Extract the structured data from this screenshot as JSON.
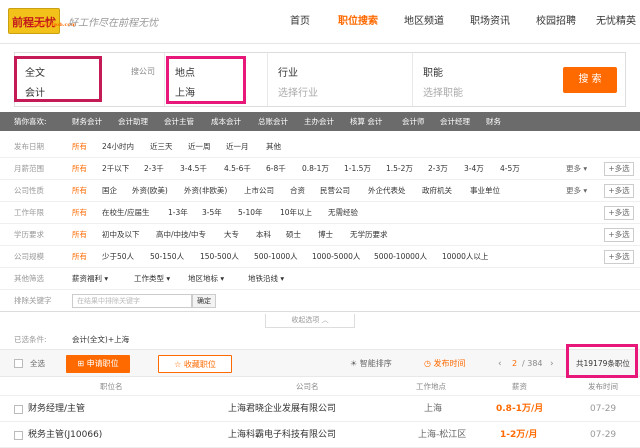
{
  "header": {
    "logo_text": "前程无忧",
    "logo_url": "www.51job.com",
    "slogan": "好工作尽在前程无忧",
    "nav": [
      "首页",
      "职位搜索",
      "地区频道",
      "职场资讯",
      "校园招聘",
      "无忧精英"
    ],
    "active_nav_index": 1
  },
  "search": {
    "keyword_type": "全文",
    "keyword_value": "会计",
    "company_label": "搜公司",
    "location_label": "地点",
    "location_value": "上海",
    "industry_label": "行业",
    "industry_placeholder": "选择行业",
    "function_label": "职能",
    "function_placeholder": "选择职能",
    "search_button": "搜 索"
  },
  "guess": {
    "label": "猜你喜欢:",
    "items": [
      "财务会计",
      "会计助理",
      "会计主管",
      "成本会计",
      "总账会计",
      "主办会计",
      "核算 会计",
      "会计师",
      "会计经理",
      "财务"
    ]
  },
  "filters": [
    {
      "label": "发布日期",
      "options": [
        "所有",
        "24小时内",
        "近三天",
        "近一周",
        "近一月",
        "其他"
      ],
      "more": "",
      "multi": ""
    },
    {
      "label": "月薪范围",
      "options": [
        "所有",
        "2千以下",
        "2-3千",
        "3-4.5千",
        "4.5-6千",
        "6-8千",
        "0.8-1万",
        "1-1.5万",
        "1.5-2万",
        "2-3万",
        "3-4万",
        "4-5万"
      ],
      "more": "更多",
      "multi": "+多选"
    },
    {
      "label": "公司性质",
      "options": [
        "所有",
        "国企",
        "外资(欧美)",
        "外资(非欧美)",
        "上市公司",
        "合资",
        "民营公司",
        "外企代表处",
        "政府机关",
        "事业单位"
      ],
      "more": "更多",
      "multi": "+多选"
    },
    {
      "label": "工作年限",
      "options": [
        "所有",
        "在校生/应届生",
        "1-3年",
        "3-5年",
        "5-10年",
        "10年以上",
        "无需经验"
      ],
      "more": "",
      "multi": "+多选"
    },
    {
      "label": "学历要求",
      "options": [
        "所有",
        "初中及以下",
        "高中/中技/中专",
        "大专",
        "本科",
        "硕士",
        "博士",
        "无学历要求"
      ],
      "more": "",
      "multi": "+多选"
    },
    {
      "label": "公司规模",
      "options": [
        "所有",
        "少于50人",
        "50-150人",
        "150-500人",
        "500-1000人",
        "1000-5000人",
        "5000-10000人",
        "10000人以上"
      ],
      "more": "",
      "multi": "+多选"
    },
    {
      "label": "其他筛选",
      "options": [
        "薪资福利",
        "工作类型",
        "地区地标",
        "地铁沿线"
      ],
      "more": "",
      "multi": ""
    }
  ],
  "exclude": {
    "label": "排除关键字",
    "placeholder": "在结果中排除关键字",
    "button": "确定"
  },
  "collapse_label": "收起选项",
  "selected": {
    "label": "已选条件:",
    "value": "会计(全文)+上海"
  },
  "toolbar": {
    "select_all": "全选",
    "apply": "申请职位",
    "favorite": "收藏职位",
    "smart_sort": "智能排序",
    "pub_time": "发布时间",
    "page": "2",
    "total_pages": "/ 384",
    "total_count": "共19179条职位"
  },
  "columns": [
    "职位名",
    "公司名",
    "工作地点",
    "薪资",
    "发布时间"
  ],
  "jobs": [
    {
      "title": "财务经理/主管",
      "company": "上海君晓企业发展有限公司",
      "location": "上海",
      "salary": "0.8-1万/月",
      "date": "07-29"
    },
    {
      "title": "税务主管(J10066)",
      "company": "上海科霸电子科技有限公司",
      "location": "上海-松江区",
      "salary": "1-2万/月",
      "date": "07-29"
    }
  ],
  "colors": {
    "accent": "#ff6a00",
    "highlight_box": "#e8177a",
    "guess_bar": "#6b6b6b"
  }
}
